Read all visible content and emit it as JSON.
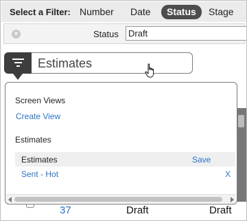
{
  "filter_bar": {
    "label": "Select a Filter:",
    "options": [
      "Number",
      "Date",
      "Status",
      "Stage"
    ],
    "active": "Status"
  },
  "criteria": {
    "label": "Status",
    "value": "Draft"
  },
  "view_selector": {
    "current": "Estimates"
  },
  "dropdown": {
    "screen_views_heading": "Screen Views",
    "create_view": "Create View",
    "estimates_heading": "Estimates",
    "items": [
      {
        "name": "Estimates",
        "action": "Save",
        "selected": true
      },
      {
        "name": "Sent - Hot",
        "action": "X",
        "selected": false
      }
    ]
  },
  "table_row": {
    "number": "37",
    "status_1": "Draft",
    "status_2": "Draft"
  },
  "colors": {
    "link": "#2a73c4",
    "active_filter_bg": "#4d4d4d",
    "menu_button_bg": "#3d3d3d"
  }
}
